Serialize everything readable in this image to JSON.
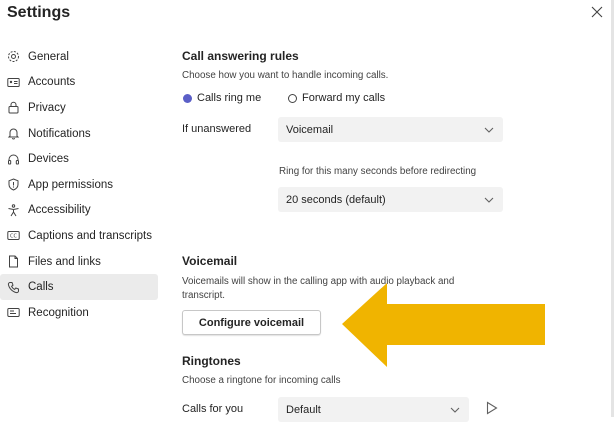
{
  "window": {
    "title": "Settings",
    "close_icon": "close-icon"
  },
  "sidebar": {
    "items": [
      {
        "label": "General",
        "icon": "gear-icon"
      },
      {
        "label": "Accounts",
        "icon": "id-card-icon"
      },
      {
        "label": "Privacy",
        "icon": "lock-icon"
      },
      {
        "label": "Notifications",
        "icon": "bell-icon"
      },
      {
        "label": "Devices",
        "icon": "headset-icon"
      },
      {
        "label": "App permissions",
        "icon": "shield-icon"
      },
      {
        "label": "Accessibility",
        "icon": "accessibility-icon"
      },
      {
        "label": "Captions and transcripts",
        "icon": "cc-icon"
      },
      {
        "label": "Files and links",
        "icon": "file-icon"
      },
      {
        "label": "Calls",
        "icon": "phone-icon"
      },
      {
        "label": "Recognition",
        "icon": "recognition-icon"
      }
    ],
    "active": "Calls",
    "active_bg": "#ebebeb"
  },
  "call_answering": {
    "heading": "Call answering rules",
    "description": "Choose how you want to handle incoming calls.",
    "option_ring": "Calls ring me",
    "option_forward": "Forward my calls",
    "selected": "Calls ring me",
    "if_unanswered_label": "If unanswered",
    "if_unanswered_value": "Voicemail",
    "ring_label": "Ring for this many seconds before redirecting",
    "ring_value": "20 seconds (default)"
  },
  "voicemail": {
    "heading": "Voicemail",
    "description_line1": "Voicemails will show in the calling app with audio playback and",
    "description_line2": "transcript.",
    "configure_button": "Configure voicemail"
  },
  "ringtones": {
    "heading": "Ringtones",
    "description": "Choose a ringtone for incoming calls",
    "calls_for_you_label": "Calls for you",
    "calls_for_you_value": "Default"
  },
  "annotation": {
    "arrow_color": "#f0b400",
    "points_to": "Configure voicemail"
  },
  "colors": {
    "accent": "#5b5fc7",
    "select_bg": "#f2f2f2"
  }
}
